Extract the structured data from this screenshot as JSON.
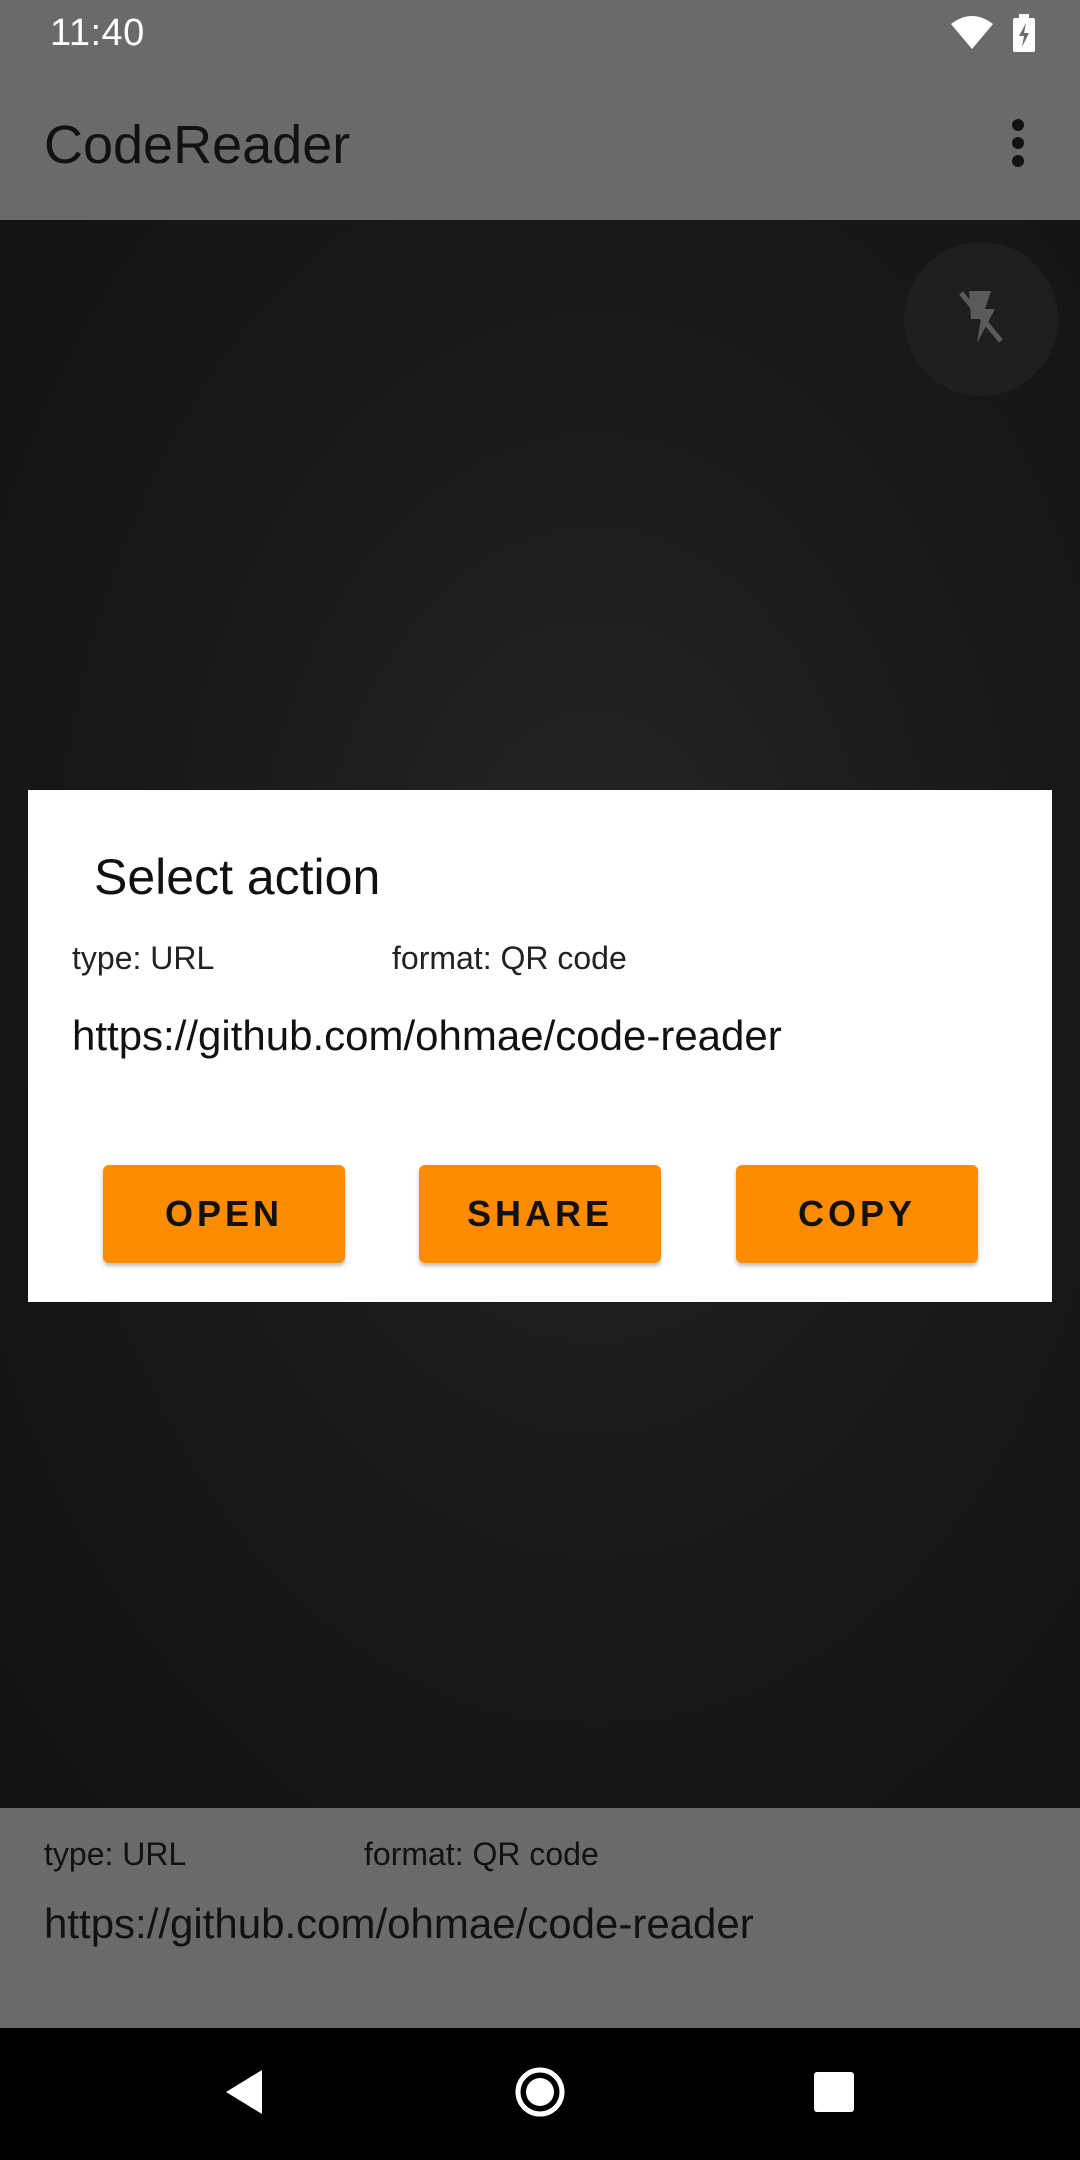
{
  "status_bar": {
    "time": "11:40",
    "icons": [
      "wifi-icon",
      "battery-charging-icon"
    ]
  },
  "app_bar": {
    "title": "CodeReader",
    "menu_icon": "more-vert-icon"
  },
  "camera": {
    "flash_icon": "flash-off-icon"
  },
  "dialog": {
    "title": "Select action",
    "type_label": "type: URL",
    "format_label": "format: QR code",
    "url": "https://github.com/ohmae/code-reader",
    "buttons": {
      "open": "OPEN",
      "share": "SHARE",
      "copy": "COPY"
    }
  },
  "result": {
    "type_label": "type: URL",
    "format_label": "format: QR code",
    "url": "https://github.com/ohmae/code-reader"
  },
  "nav_bar": {
    "icons": [
      "back-icon",
      "home-icon",
      "recents-icon"
    ]
  },
  "colors": {
    "accent": "#ff8c00",
    "bar": "#6a6a6a",
    "dialog": "#ffffff"
  }
}
